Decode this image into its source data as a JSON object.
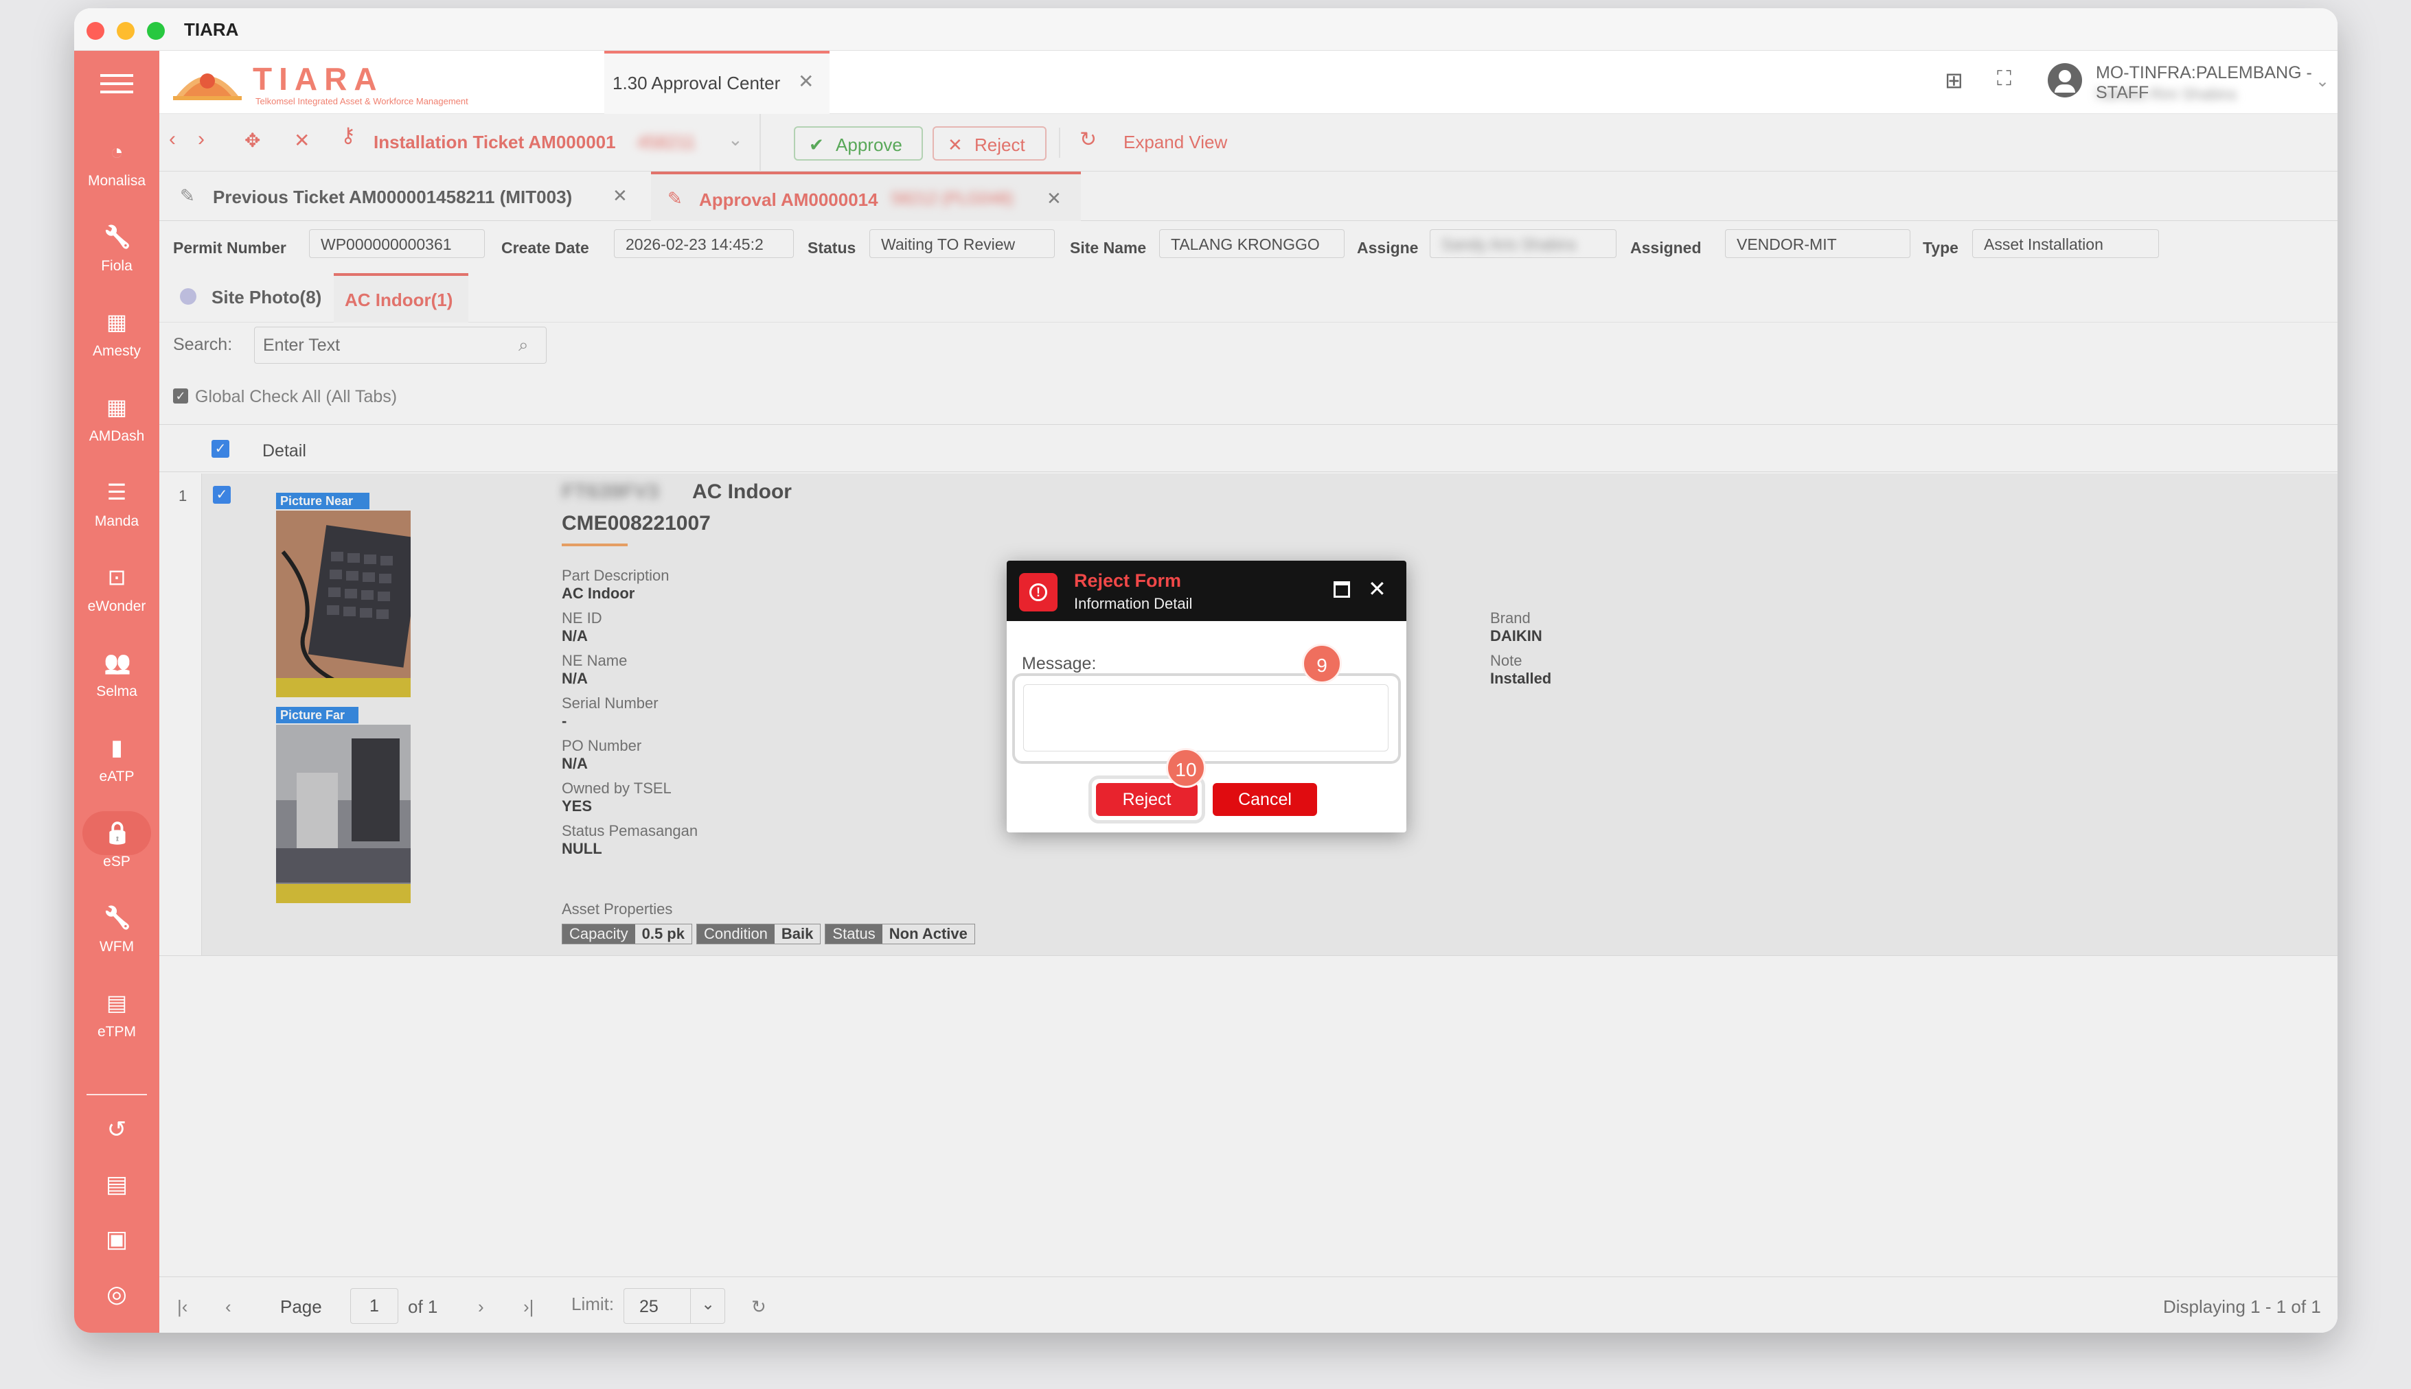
{
  "window": {
    "title": "TIARA"
  },
  "logo": {
    "brand": "TIARA",
    "tagline": "Telkomsel Integrated Asset & Workforce Management"
  },
  "header": {
    "tab_label": "1.30 Approval Center",
    "user_role": "MO-TINFRA:PALEMBANG - STAFF",
    "user_name": "Nahdia Rini Shabira"
  },
  "sidebar": {
    "items": [
      {
        "label": "Monalisa",
        "icon": "pie-chart-icon"
      },
      {
        "label": "Fiola",
        "icon": "wrench-icon"
      },
      {
        "label": "Amesty",
        "icon": "clipboard-icon"
      },
      {
        "label": "AMDash",
        "icon": "clipboard-icon"
      },
      {
        "label": "Manda",
        "icon": "server-icon"
      },
      {
        "label": "eWonder",
        "icon": "inbox-icon"
      },
      {
        "label": "Selma",
        "icon": "people-icon"
      },
      {
        "label": "eATP",
        "icon": "book-icon"
      },
      {
        "label": "eSP",
        "icon": "lock-icon"
      },
      {
        "label": "WFM",
        "icon": "wrench-icon"
      },
      {
        "label": "eTPM",
        "icon": "list-icon"
      }
    ]
  },
  "toolbar": {
    "ticket_title": "Installation Ticket AM000001",
    "ticket_title_hidden": "458211",
    "approve_label": "Approve",
    "reject_label": "Reject",
    "expand_label": "Expand View"
  },
  "subtabs": {
    "prev_label": "Previous Ticket AM000001458211 (MIT003)",
    "approval_label": "Approval AM0000014",
    "approval_hidden": "58212 (PLG048)"
  },
  "fields": {
    "permit_label": "Permit Number",
    "permit_value": "WP000000000361",
    "create_label": "Create Date",
    "create_value": "2026-02-23 14:45:2",
    "status_label": "Status",
    "status_value": "Waiting TO Review",
    "site_label": "Site Name",
    "site_value": "TALANG KRONGGO",
    "assigne_label": "Assigne",
    "assigne_value": "Sandy Aris Shabira",
    "assigned_label": "Assigned",
    "assigned_value": "VENDOR-MIT",
    "type_label": "Type",
    "type_value": "Asset Installation"
  },
  "phototabs": {
    "site_photo": "Site Photo(8)",
    "ac_indoor": "AC Indoor(1)"
  },
  "search": {
    "label": "Search:",
    "placeholder": "Enter Text"
  },
  "global_check": "Global Check All (All Tabs)",
  "grid": {
    "col_detail": "Detail",
    "row_index": "1",
    "picture_near": "Picture Near",
    "picture_far": "Picture Far",
    "item_code_hidden": "FT639FV3",
    "item_title": "AC Indoor",
    "item_id": "CME008221007",
    "details_left": [
      {
        "label": "Part Description",
        "value": "AC Indoor"
      },
      {
        "label": "NE ID",
        "value": "N/A"
      },
      {
        "label": "NE Name",
        "value": "N/A"
      },
      {
        "label": "Serial Number",
        "value": "-"
      },
      {
        "label": "PO Number",
        "value": "N/A"
      },
      {
        "label": "Owned by TSEL",
        "value": "YES"
      },
      {
        "label": "Status Pemasangan",
        "value": "NULL"
      }
    ],
    "asset_props_label": "Asset Properties",
    "props": [
      {
        "key": "Capacity",
        "value": "0.5 pk"
      },
      {
        "key": "Condition",
        "value": "Baik"
      },
      {
        "key": "Status",
        "value": "Non Active"
      }
    ],
    "details_right": [
      {
        "label": "Brand",
        "value": "DAIKIN"
      },
      {
        "label": "Note",
        "value": "Installed"
      }
    ]
  },
  "modal": {
    "title": "Reject Form",
    "subtitle": "Information Detail",
    "message_label": "Message:",
    "message_value": "",
    "reject_label": "Reject",
    "cancel_label": "Cancel",
    "badge_9": "9",
    "badge_10": "10"
  },
  "pager": {
    "page_label": "Page",
    "page_value": "1",
    "of_label": "of 1",
    "limit_label": "Limit:",
    "limit_value": "25",
    "display_label": "Displaying 1 - 1 of 1"
  },
  "colors": {
    "accent": "#f07a72",
    "reject_red": "#e8232d",
    "approve_green": "#4caf50"
  }
}
